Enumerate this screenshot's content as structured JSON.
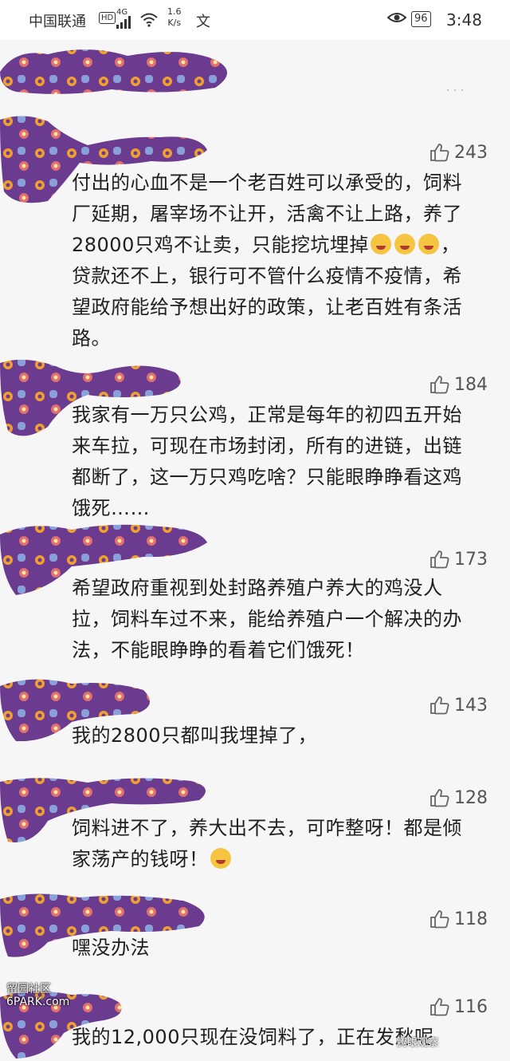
{
  "status_bar": {
    "carrier": "中国联通",
    "hd": "HD",
    "network": "4G",
    "speed_value": "1.6",
    "speed_unit": "K/s",
    "input_method": "文",
    "battery": "96",
    "time": "3:48"
  },
  "comments": [
    {
      "likes": "243",
      "text_before": "付出的心血不是一个老百姓可以承受的，饲料厂延期，屠宰场不让开，活禽不让上路，养了28000只鸡不让卖，只能挖坑埋掉",
      "text_after": "，贷款还不上，银行可不管什么疫情不疫情，希望政府能给予想出好的政策，让老百姓有条活路。"
    },
    {
      "likes": "184",
      "text": "我家有一万只公鸡，正常是每年的初四五开始来车拉，可现在市场封闭，所有的进链，出链都断了，这一万只鸡吃啥？只能眼睁睁看这鸡饿死……"
    },
    {
      "likes": "173",
      "text": "希望政府重视到处封路养殖户养大的鸡没人拉，饲料车过不来，能给养殖户一个解决的办法，不能眼睁睁的看着它们饿死！"
    },
    {
      "likes": "143",
      "text": "我的2800只都叫我埋掉了，"
    },
    {
      "likes": "128",
      "text": "饲料进不了，养大出不去，可咋整呀！都是倾家荡产的钱呀！"
    },
    {
      "likes": "118",
      "text": "嘿没办法"
    },
    {
      "likes": "116",
      "text": "我的12,000只现在没饲料了，正在发愁呢"
    }
  ],
  "watermarks": {
    "left_line1": "留园社区",
    "left_line2": "6PARK.com",
    "right": "腾眼观察"
  }
}
